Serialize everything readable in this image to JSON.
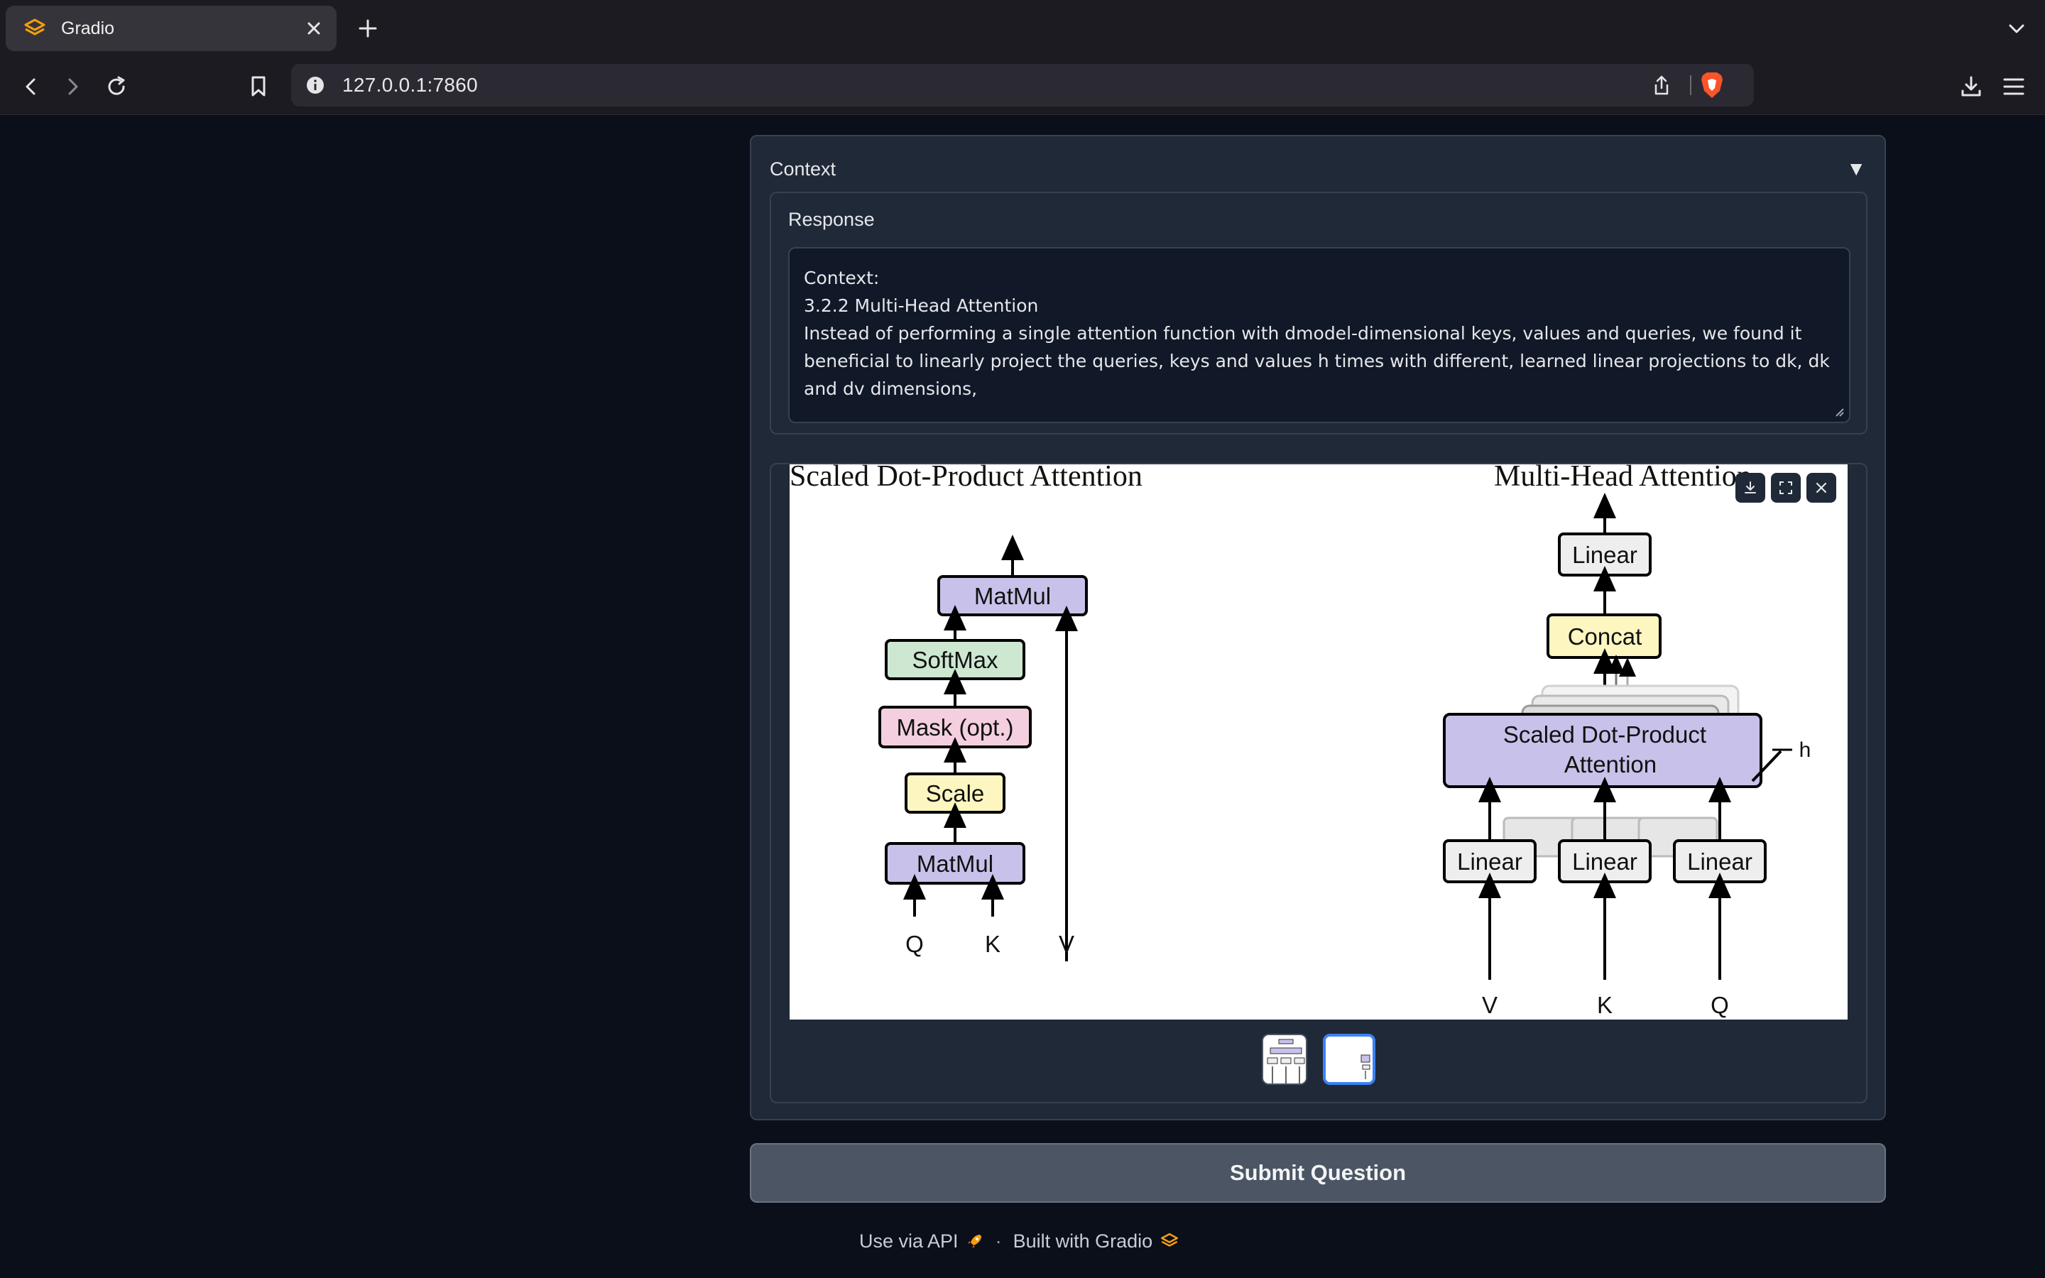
{
  "browser": {
    "tab_title": "Gradio",
    "url": "127.0.0.1:7860"
  },
  "accordion": {
    "title": "Context",
    "arrow": "▼"
  },
  "response": {
    "label": "Response",
    "lines": [
      "Context:",
      "",
      "3.2.2 Multi-Head Attention",
      "",
      "Instead of performing a single attention function with dmodel-dimensional keys, values and queries, we found it beneficial to linearly project the queries, keys and values h times with different, learned linear projections to dk, dk and dv dimensions,"
    ]
  },
  "figure": {
    "left_title": "Scaled Dot-Product Attention",
    "right_title": "Multi-Head Attention",
    "left_boxes": {
      "matmul_top": "MatMul",
      "softmax": "SoftMax",
      "mask": "Mask (opt.)",
      "scale": "Scale",
      "matmul_bottom": "MatMul"
    },
    "left_inputs": {
      "q": "Q",
      "k": "K",
      "v": "V"
    },
    "right_boxes": {
      "linear_top": "Linear",
      "concat": "Concat",
      "sdpa_line1": "Scaled Dot-Product",
      "sdpa_line2": "Attention",
      "h_label": "h",
      "linear_1": "Linear",
      "linear_2": "Linear",
      "linear_3": "Linear"
    },
    "right_inputs": {
      "v": "V",
      "k": "K",
      "q": "Q"
    },
    "colors": {
      "purple": "#c8c2ea",
      "green": "#cde7d0",
      "pink": "#f4cfdf",
      "yellow": "#fdf6c0",
      "gray": "#eeeeee"
    }
  },
  "submit": {
    "label": "Submit Question"
  },
  "footer": {
    "api": "Use via API",
    "separator": "·",
    "built": "Built with Gradio"
  },
  "icons": {
    "tab_favicon": "gradio-logo-icon",
    "download": "download-icon",
    "fullscreen": "fullscreen-icon",
    "close": "close-icon"
  }
}
